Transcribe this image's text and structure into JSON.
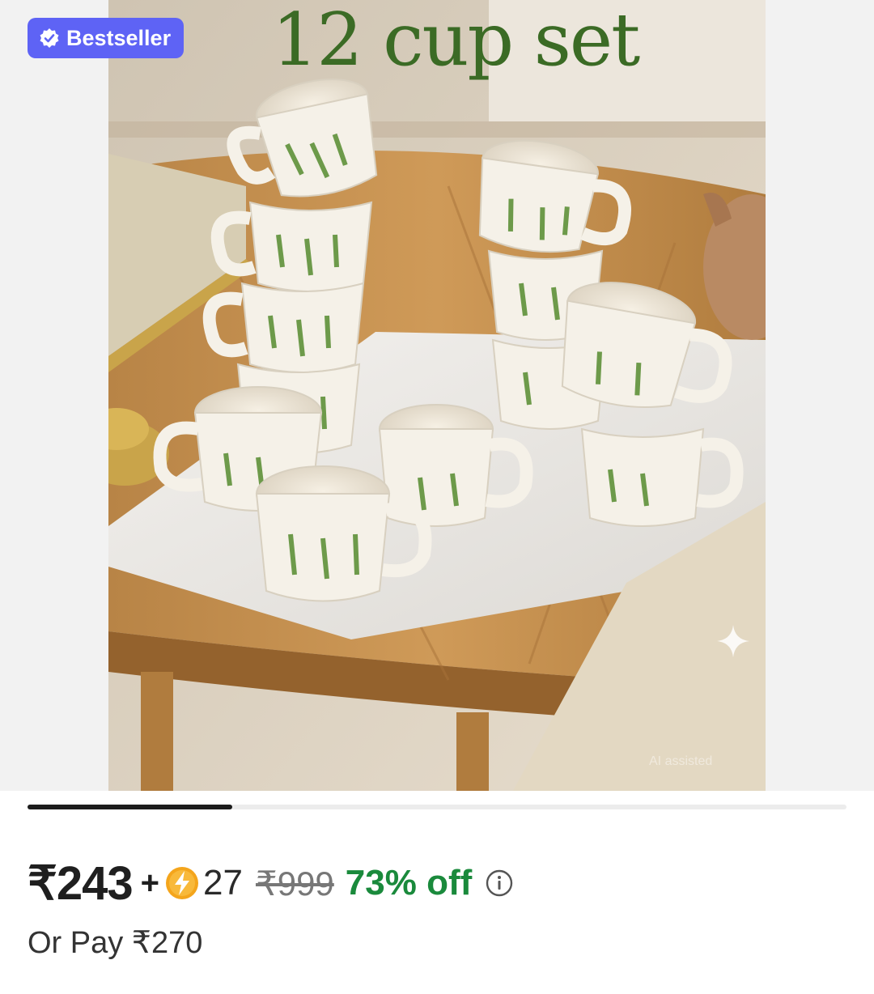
{
  "badge": {
    "label": "Bestseller",
    "icon": "verified-check-icon",
    "color": "#5e63f5"
  },
  "image": {
    "overlay_title": "12 cup set",
    "watermark": "AI assisted",
    "title_color": "#3b6b25"
  },
  "carousel": {
    "progress": 0.25
  },
  "pricing": {
    "price": "₹243",
    "plus": "+",
    "coin_icon": "lightning-coin-icon",
    "coins": "27",
    "mrp": "₹999",
    "discount": "73% off",
    "discount_color": "#1a8a3c",
    "info_icon": "info-icon",
    "alt_pay": "Or Pay ₹270"
  }
}
